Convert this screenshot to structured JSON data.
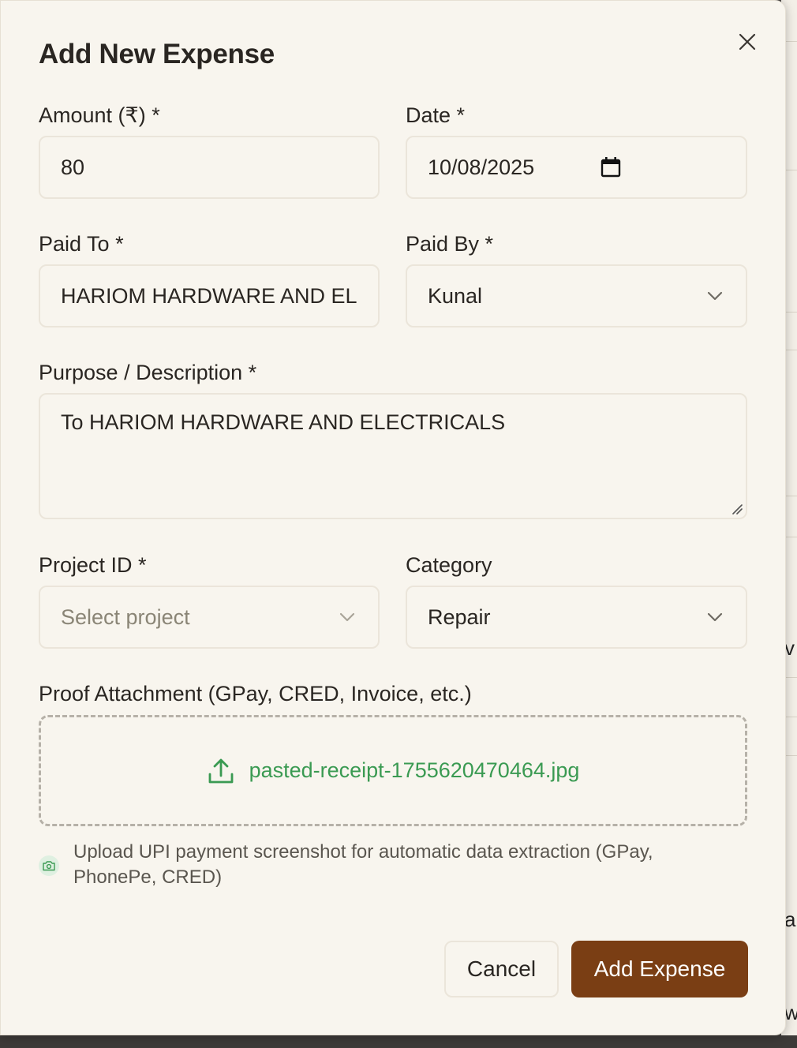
{
  "backdrop": {
    "edge_letters": [
      "v",
      "a",
      "w"
    ]
  },
  "dialog": {
    "title": "Add New Expense",
    "close_icon": "close-icon",
    "amount": {
      "label": "Amount (₹) *",
      "value": "80"
    },
    "date": {
      "label": "Date *",
      "value": "10/08/2025",
      "icon": "calendar-icon"
    },
    "paid_to": {
      "label": "Paid To *",
      "value": "HARIOM HARDWARE AND EL"
    },
    "paid_by": {
      "label": "Paid By *",
      "value": "Kunal",
      "icon": "chevron-down-icon"
    },
    "purpose": {
      "label": "Purpose / Description *",
      "value": "To HARIOM HARDWARE AND ELECTRICALS"
    },
    "project": {
      "label": "Project ID *",
      "placeholder": "Select project",
      "icon": "chevron-down-icon"
    },
    "category": {
      "label": "Category",
      "value": "Repair",
      "icon": "chevron-down-icon"
    },
    "attachment": {
      "label": "Proof Attachment (GPay, CRED, Invoice, etc.)",
      "file_name": "pasted-receipt-1755620470464.jpg",
      "icon": "upload-icon",
      "hint": "Upload UPI payment screenshot for automatic data extraction (GPay, PhonePe, CRED)",
      "hint_icon": "camera-icon"
    },
    "actions": {
      "cancel_label": "Cancel",
      "submit_label": "Add Expense"
    }
  },
  "colors": {
    "dialog_bg": "#f8f5ee",
    "primary": "#7a3e14",
    "file_green": "#3a9a52",
    "border": "#ebe5da"
  }
}
